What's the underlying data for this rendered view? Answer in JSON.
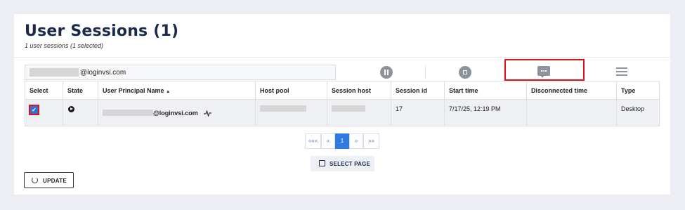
{
  "header": {
    "title": "User Sessions (1)",
    "subtitle": "1 user sessions (1 selected)"
  },
  "filter": {
    "value_suffix": "@loginvsi.com"
  },
  "toolbar": {
    "icons": [
      "pause-icon",
      "stop-icon",
      "message-icon",
      "menu-icon"
    ]
  },
  "table": {
    "columns": [
      "Select",
      "State",
      "User Principal Name",
      "Host pool",
      "Session host",
      "Session id",
      "Start time",
      "Disconnected time",
      "Type"
    ],
    "sort_indicator": "▲",
    "rows": [
      {
        "selected": true,
        "upn_suffix": "@loginvsi.com",
        "session_id": "17",
        "start_time": "7/17/25, 12:19 PM",
        "disconnected_time": "",
        "type": "Desktop"
      }
    ]
  },
  "pagination": {
    "first": "«««",
    "prev": "«",
    "current": "1",
    "next": "»",
    "last": "»»"
  },
  "buttons": {
    "select_page": "SELECT PAGE",
    "update": "UPDATE"
  },
  "colors": {
    "accent": "#2f7be0",
    "highlight": "#d9141c",
    "title": "#1b2a4a"
  }
}
